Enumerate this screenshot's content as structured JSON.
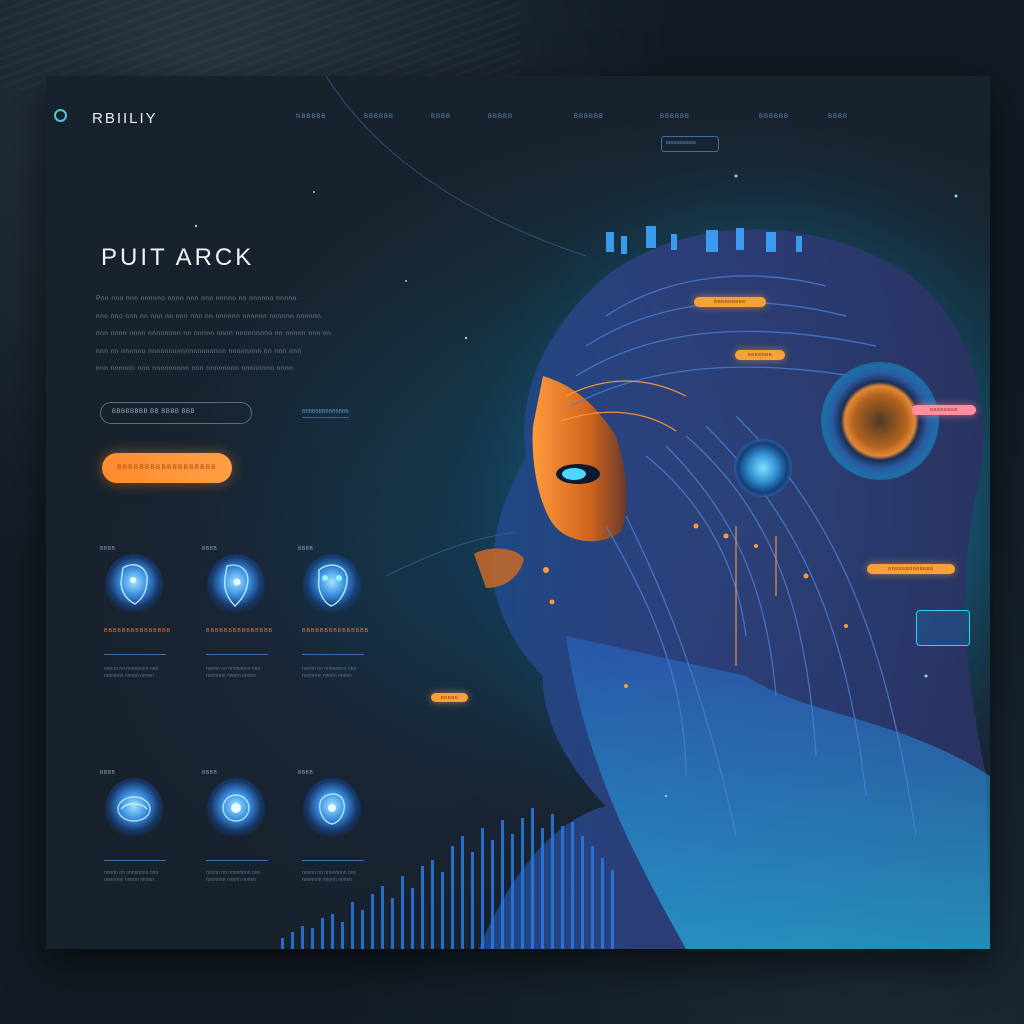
{
  "brand": {
    "name": "RBIILIY"
  },
  "nav": {
    "items": [
      "NBBBBB",
      "BBBBBB",
      "BBBB",
      "BBBBB",
      "BBBBBB",
      "BBBBBB",
      "BBBBBB",
      "BBBB"
    ]
  },
  "hero": {
    "title": "PUIT ARCK",
    "lines": [
      "Pnn nno nnn nnnnno nnnn nnn nnn nnnno nn nnnnno nnnnn.",
      "nno nno nnn nn nnn nn nnn nnn nn nnnnnn nnnnnn nnnnnn nnnnnn",
      "nnn nnnn nnnn nnnnnnnn nn nnnnn nnnn nnnnnnnno nn nnnnn nnn nn",
      "nnn nn nnnnno nnnnnnnnnnnnnnnnnnn nnnnnnnn nn nnn nnn",
      "nnn nnnnnn nnn nnnnnnnnn nnn nnnnnnnn nnnnnnnn nnnn"
    ],
    "email_placeholder": "BBBBBBBB BB BBBB BBB",
    "field_note": "BBBBBBBBBBBBBB",
    "cta_label": "BBBBBBBBBBBBBBBBBB"
  },
  "cards": [
    {
      "tag": "BBBB",
      "title": "BBBBBBBBBBBBBBB",
      "text": "nnnnn nn nnnnnnnn nnn nnnnnnn nnnnn nnnnn"
    },
    {
      "tag": "BBBB",
      "title": "BBBBBBBBBBBBBBB",
      "text": "nnnnn nn nnnnnnnn nnn nnnnnnn nnnnn nnnnn"
    },
    {
      "tag": "BBBB",
      "title": "BBBBBBBBBBBBBBB",
      "text": "nnnnn nn nnnnnnnn nnn nnnnnnn nnnnn nnnnn"
    },
    {
      "tag": "BBBB",
      "title": "",
      "text": "nnnnn nn nnnnnnnn nnn nnnnnnn nnnnn nnnnn"
    },
    {
      "tag": "BBBB",
      "title": "",
      "text": "nnnnn nn nnnnnnnn nnn nnnnnnn nnnnn nnnnn"
    },
    {
      "tag": "BBBB",
      "title": "",
      "text": "nnnnn nn nnnnnnnn nnn nnnnnnn nnnnn nnnnn"
    }
  ],
  "illustration": {
    "chips": [
      "BBBBBBBBB",
      "BBBBBBB",
      "BBBBBBBB",
      "BBBBBBBBBBBBB",
      "BBBBB"
    ],
    "panel_label": "BBBBBBBBBB"
  },
  "colors": {
    "accent": "#ff8c2e",
    "cyan": "#2fd0ff",
    "blue": "#3a8ee0",
    "background": "#18222d"
  }
}
